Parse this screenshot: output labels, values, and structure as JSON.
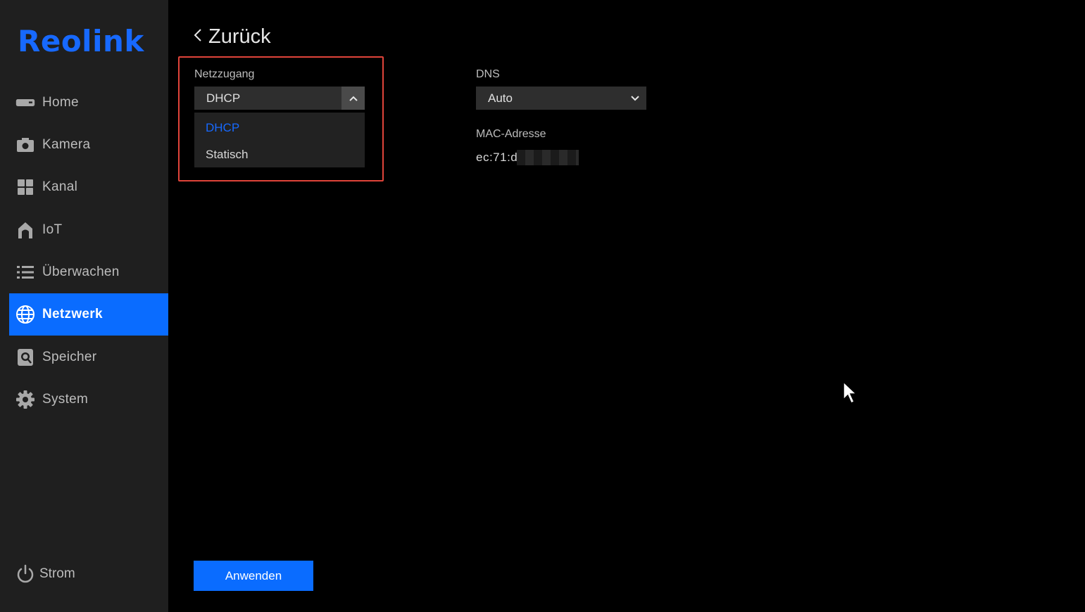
{
  "brand": {
    "name": "Reolink",
    "color": "#1769ff"
  },
  "sidebar": {
    "items": [
      {
        "id": "home",
        "label": "Home",
        "icon": "home-tv-icon",
        "active": false
      },
      {
        "id": "kamera",
        "label": "Kamera",
        "icon": "camera-icon",
        "active": false
      },
      {
        "id": "kanal",
        "label": "Kanal",
        "icon": "grid-icon",
        "active": false
      },
      {
        "id": "iot",
        "label": "IoT",
        "icon": "house-icon",
        "active": false
      },
      {
        "id": "ueberwachen",
        "label": "Überwachen",
        "icon": "list-icon",
        "active": false
      },
      {
        "id": "netzwerk",
        "label": "Netzwerk",
        "icon": "globe-icon",
        "active": true
      },
      {
        "id": "speicher",
        "label": "Speicher",
        "icon": "storage-icon",
        "active": false
      },
      {
        "id": "system",
        "label": "System",
        "icon": "gear-icon",
        "active": false
      }
    ],
    "power": {
      "label": "Strom",
      "icon": "power-icon"
    }
  },
  "header": {
    "back_label": "Zurück"
  },
  "netzzugang": {
    "label": "Netzzugang",
    "value": "DHCP",
    "options": [
      {
        "label": "DHCP",
        "selected": true
      },
      {
        "label": "Statisch",
        "selected": false
      }
    ]
  },
  "dns": {
    "label": "DNS",
    "value": "Auto"
  },
  "mac": {
    "label": "MAC-Adresse",
    "value": "ec:71:d"
  },
  "actions": {
    "apply_label": "Anwenden"
  },
  "colors": {
    "accent": "#0a6cff",
    "highlight": "#e0443a",
    "selected_option": "#1769ff"
  }
}
